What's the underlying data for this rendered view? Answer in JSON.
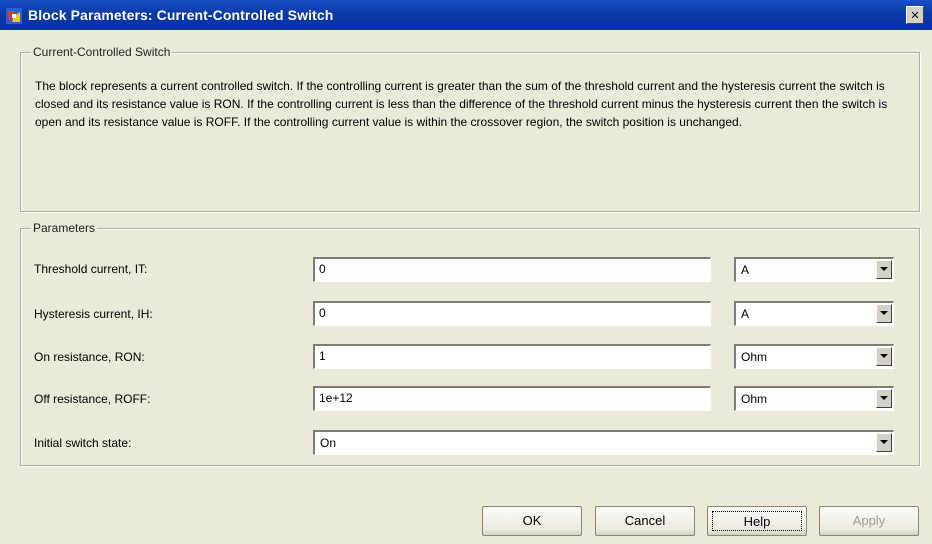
{
  "window": {
    "title": "Block Parameters: Current-Controlled Switch",
    "close_glyph": "✕"
  },
  "description_group": {
    "legend": "Current-Controlled Switch",
    "text": "The block represents a current controlled switch. If the controlling current is greater than the sum of the threshold current and the hysteresis current the switch is closed and its resistance value is RON. If the controlling current is less than the difference of the threshold current minus the hysteresis current then the switch is open and its resistance value is ROFF. If the controlling current value is within the crossover region, the switch position is unchanged."
  },
  "parameters": {
    "legend": "Parameters",
    "rows": [
      {
        "label": "Threshold current, IT:",
        "value": "0",
        "unit": "A"
      },
      {
        "label": "Hysteresis current, IH:",
        "value": "0",
        "unit": "A"
      },
      {
        "label": "On resistance, RON:",
        "value": "1",
        "unit": "Ohm"
      },
      {
        "label": "Off resistance, ROFF:",
        "value": "1e+12",
        "unit": "Ohm"
      }
    ],
    "initial_state": {
      "label": "Initial switch state:",
      "value": "On"
    }
  },
  "buttons": {
    "ok": "OK",
    "cancel": "Cancel",
    "help": "Help",
    "apply": "Apply"
  },
  "colors": {
    "titlebar": "#0a39a8",
    "dialog_bg": "#ece9d8",
    "disabled_text": "#a19f92"
  }
}
